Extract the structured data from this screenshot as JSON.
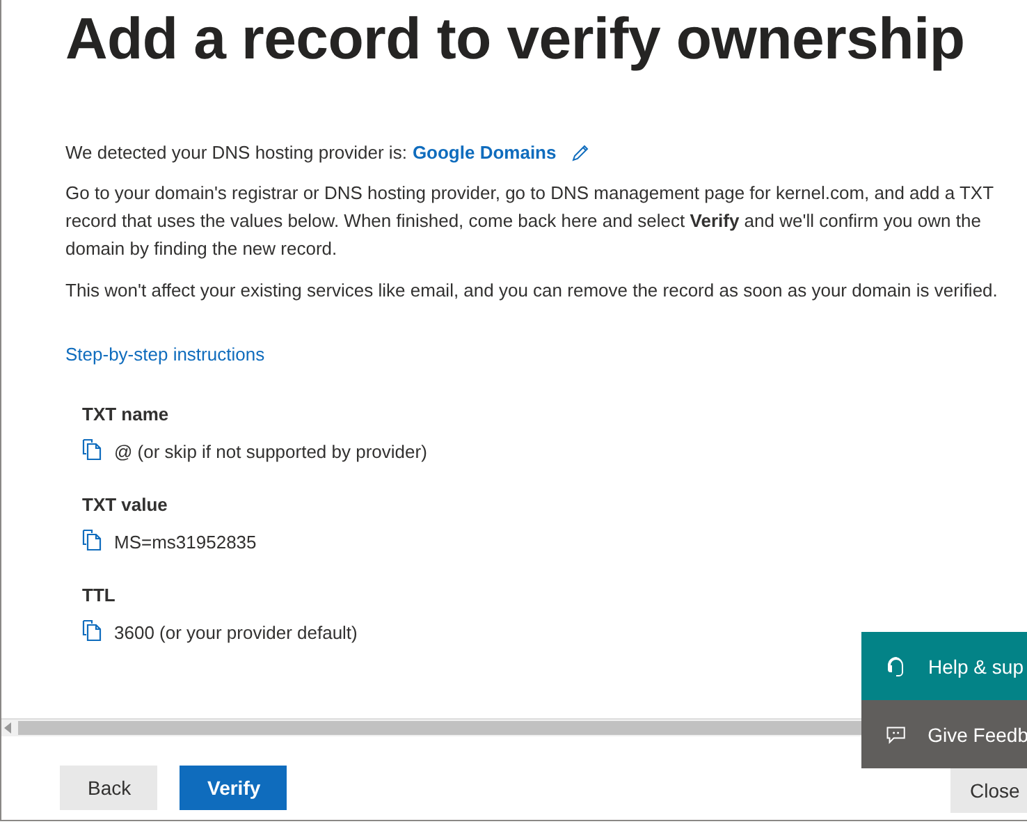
{
  "title": "Add a record to verify ownership",
  "provider_line": {
    "text": "We detected your DNS hosting provider is:",
    "provider": "Google Domains"
  },
  "paragraphs": [
    "Go to your domain's registrar or DNS hosting provider, go to DNS management page for kernel.com, and add a TXT record that uses the values below. When finished, come back here and select **Verify** and we'll confirm you own the domain by finding the new record.",
    "This won't affect your existing services like email, and you can remove the record as soon as your domain is verified."
  ],
  "instructions_link": "Step-by-step instructions",
  "records": [
    {
      "label": "TXT name",
      "value": "@ (or skip if not supported by provider)"
    },
    {
      "label": "TXT value",
      "value": "MS=ms31952835"
    },
    {
      "label": "TTL",
      "value": "3600 (or your provider default)"
    }
  ],
  "side_panels": [
    {
      "kind": "help",
      "label": "Help & sup"
    },
    {
      "kind": "feedback",
      "label": "Give Feedb"
    }
  ],
  "footer_buttons": [
    {
      "label": "Back",
      "kind": "secondary"
    },
    {
      "label": "Verify",
      "kind": "primary"
    },
    {
      "label": "Close",
      "kind": "close"
    }
  ]
}
